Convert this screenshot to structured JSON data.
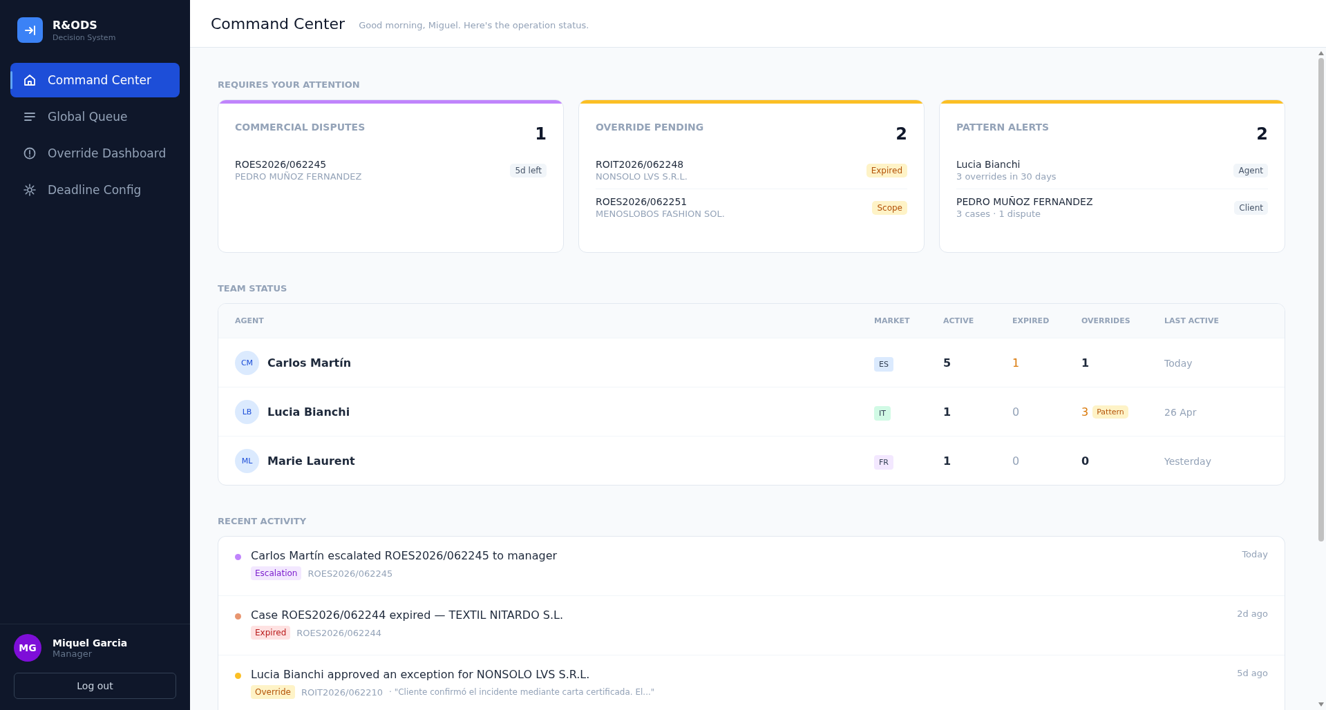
{
  "brand": {
    "name": "R&ODS",
    "subtitle": "Decision System"
  },
  "nav": [
    {
      "label": "Command Center",
      "selected": true
    },
    {
      "label": "Global Queue",
      "selected": false
    },
    {
      "label": "Override Dashboard",
      "selected": false
    },
    {
      "label": "Deadline Config",
      "selected": false
    }
  ],
  "user": {
    "initials": "MG",
    "name": "Miquel Garcia",
    "role": "Manager",
    "logout": "Log out"
  },
  "header": {
    "title": "Command Center",
    "greeting": "Good morning, Miguel. Here's the operation status."
  },
  "attention": {
    "label": "REQUIRES YOUR ATTENTION",
    "cards": [
      {
        "title": "COMMERCIAL DISPUTES",
        "count": "1",
        "color": "#c084fc",
        "items": [
          {
            "primary": "ROES2026/062245",
            "secondary": "PEDRO MUÑOZ FERNANDEZ",
            "badge": "5d left",
            "kind": "neutral"
          }
        ]
      },
      {
        "title": "OVERRIDE PENDING",
        "count": "2",
        "color": "#fbbf24",
        "items": [
          {
            "primary": "ROIT2026/062248",
            "secondary": "NONSOLO LVS S.R.L.",
            "badge": "Expired",
            "kind": "warning"
          },
          {
            "primary": "ROES2026/062251",
            "secondary": "MENOSLOBOS FASHION SOL.",
            "badge": "Scope",
            "kind": "warning"
          }
        ]
      },
      {
        "title": "PATTERN ALERTS",
        "count": "2",
        "color": "#fbbf24",
        "items": [
          {
            "primary": "Lucia Bianchi",
            "secondary": "3 overrides in 30 days",
            "badge": "Agent",
            "kind": "neutral"
          },
          {
            "primary": "PEDRO MUÑOZ FERNANDEZ",
            "secondary": "3 cases · 1 dispute",
            "badge": "Client",
            "kind": "neutral"
          }
        ]
      }
    ]
  },
  "team": {
    "label": "TEAM STATUS",
    "columns": [
      "AGENT",
      "MARKET",
      "ACTIVE",
      "EXPIRED",
      "OVERRIDES",
      "LAST ACTIVE"
    ],
    "rows": [
      {
        "initials": "CM",
        "name": "Carlos Martín",
        "market": "ES",
        "color": "#dbeafe",
        "active": {
          "value": "5",
          "kind": "normal"
        },
        "expired": {
          "value": "1",
          "kind": "alert"
        },
        "overrides": {
          "value": "1",
          "kind": "normal"
        },
        "last_active": "Today"
      },
      {
        "initials": "LB",
        "name": "Lucia Bianchi",
        "market": "IT",
        "color": "#d1fae5",
        "active": {
          "value": "1",
          "kind": "normal"
        },
        "expired": {
          "value": "0",
          "kind": "muted"
        },
        "overrides": {
          "value": "3",
          "kind": "alert",
          "badge": "Pattern"
        },
        "last_active": "26 Apr"
      },
      {
        "initials": "ML",
        "name": "Marie Laurent",
        "market": "FR",
        "color": "#f3e8ff",
        "active": {
          "value": "1",
          "kind": "normal"
        },
        "expired": {
          "value": "0",
          "kind": "muted"
        },
        "overrides": {
          "value": "0",
          "kind": "normal"
        },
        "last_active": "Yesterday"
      }
    ]
  },
  "activity": {
    "label": "RECENT ACTIVITY",
    "items": [
      {
        "text": "Carlos Martín escalated ROES2026/062245 to manager",
        "color": "#c084fc",
        "tag": "Escalation",
        "kind": "escalation",
        "ref": "ROES2026/062245",
        "time": "Today"
      },
      {
        "text": "Case ROES2026/062244 expired — TEXTIL NITARDO S.L.",
        "color": "#e8956f",
        "tag": "Expired",
        "kind": "expired",
        "ref": "ROES2026/062244",
        "time": "2d ago"
      },
      {
        "text": "Lucia Bianchi approved an exception for NONSOLO LVS S.R.L.",
        "color": "#fbbf24",
        "tag": "Override",
        "kind": "override",
        "ref": "ROIT2026/062210",
        "note": "· \"Cliente confirmó el incidente mediante carta certificada. El...\"",
        "time": "5d ago"
      }
    ]
  }
}
